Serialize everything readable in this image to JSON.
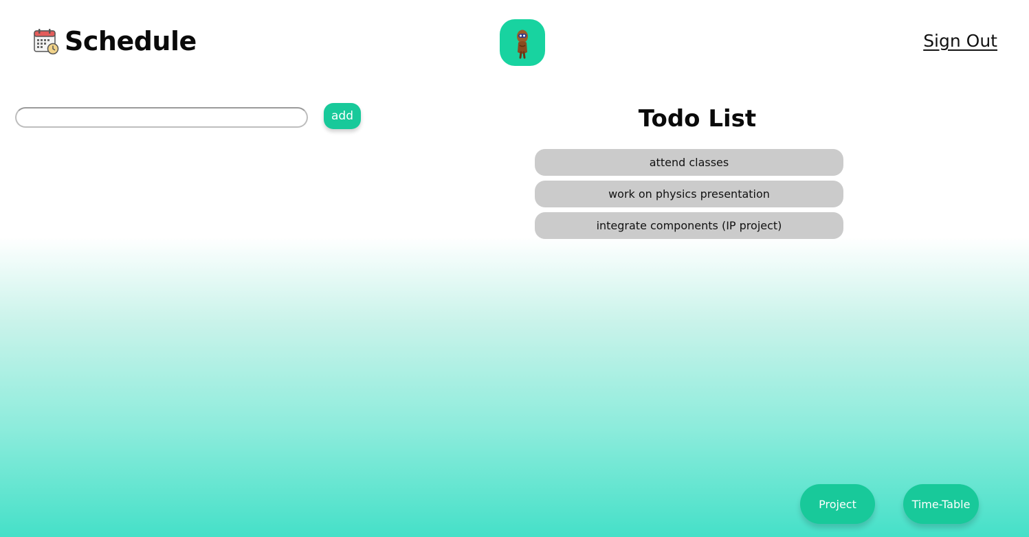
{
  "header": {
    "title": "Schedule",
    "title_icon": "calendar-icon",
    "logo_icon": "mascot-logo-icon",
    "signout_label": "Sign Out"
  },
  "task_form": {
    "input_value": "",
    "input_placeholder": "",
    "add_label": "add"
  },
  "todo": {
    "heading": "Todo List",
    "items": [
      "attend classes",
      "work on physics presentation",
      "integrate components (IP project)"
    ]
  },
  "nav": {
    "project_label": "Project",
    "timetable_label": "Time-Table"
  },
  "colors": {
    "accent": "#18c99a",
    "todo_item_bg": "#cbcbcb",
    "gradient_bottom": "#45e0c8"
  }
}
